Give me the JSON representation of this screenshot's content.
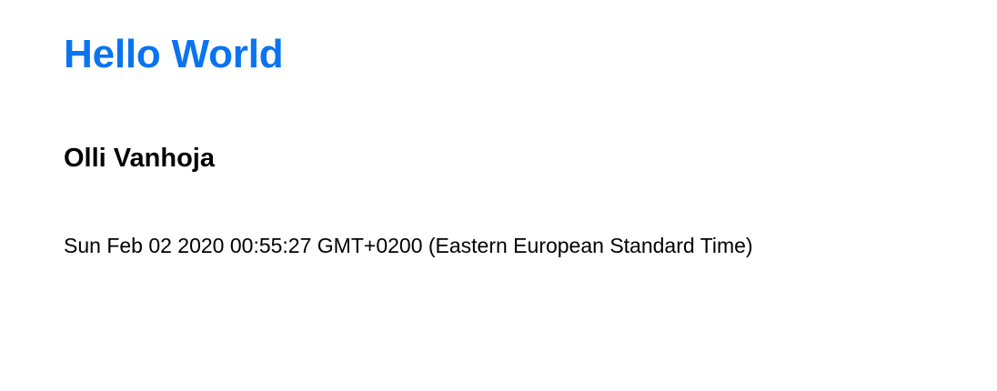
{
  "colors": {
    "title": "#0a74f0",
    "text": "#000000",
    "background": "#ffffff"
  },
  "page": {
    "title": "Hello World",
    "author": "Olli Vanhoja",
    "timestamp": "Sun Feb 02 2020 00:55:27 GMT+0200 (Eastern European Standard Time)"
  }
}
